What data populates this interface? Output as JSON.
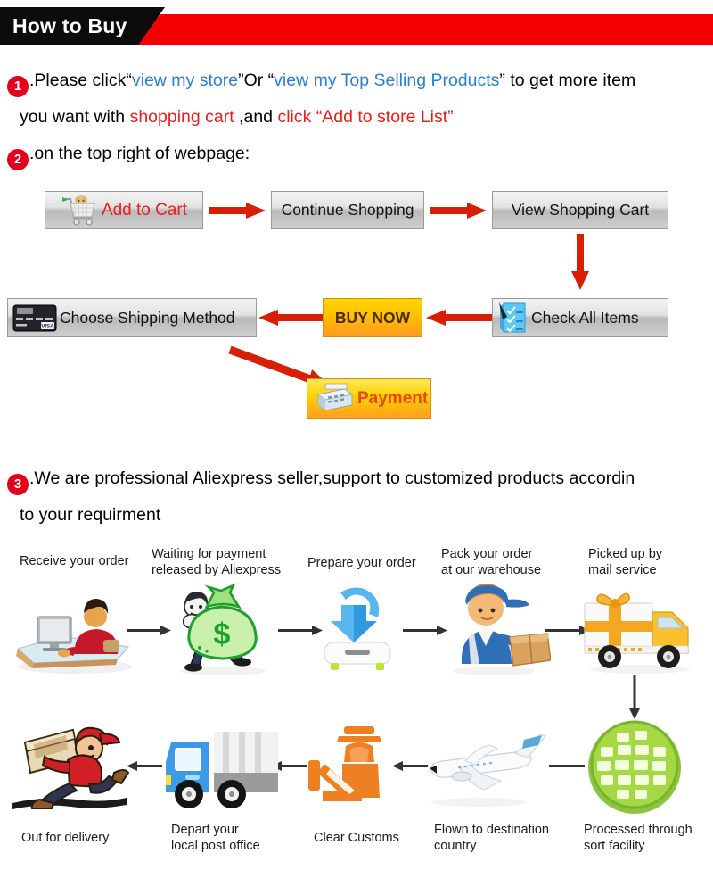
{
  "header": {
    "title": "How to Buy",
    "black_color": "#0c0c0c",
    "red_color": "#f40000"
  },
  "steps": {
    "one": {
      "number": "1",
      "line1_a": ".Please click“",
      "line1_link1": "view my store",
      "line1_b": "”Or “",
      "line1_link2": "view my Top Selling Products",
      "line1_c": "” to get more item",
      "line2_a": "you want with ",
      "line2_red1": "shopping cart",
      "line2_b": " ,and ",
      "line2_red2": "click “Add to store List”"
    },
    "two": {
      "number": "2",
      "text": ".on the top right of webpage:"
    },
    "three": {
      "number": "3",
      "line1": ".We are professional Aliexpress seller,support to customized products accordin",
      "line2": "to your requirment"
    }
  },
  "buttons": {
    "add_to_cart": "Add to Cart",
    "continue_shopping": "Continue Shopping",
    "view_shopping_cart": "View Shopping Cart",
    "choose_shipping_method": "Choose Shipping Method",
    "buy_now": "BUY NOW",
    "check_all_items": "Check All Items",
    "payment": "Payment",
    "visa_label": "VISA"
  },
  "process": {
    "top_row": [
      {
        "label_line1": "Receive your order",
        "label_line2": "",
        "icon": "person-at-computer-icon"
      },
      {
        "label_line1": "Waiting for payment",
        "label_line2": "released by Aliexpress",
        "icon": "money-bag-icon"
      },
      {
        "label_line1": "Prepare your order",
        "label_line2": "",
        "icon": "download-arrow-icon"
      },
      {
        "label_line1": "Pack your order",
        "label_line2": "at our warehouse",
        "icon": "warehouse-worker-icon"
      },
      {
        "label_line1": "Picked up by",
        "label_line2": "mail service",
        "icon": "gift-truck-icon"
      }
    ],
    "bottom_row": [
      {
        "label_line1": "Out for delivery",
        "label_line2": "",
        "icon": "running-courier-icon"
      },
      {
        "label_line1": "Depart your",
        "label_line2": "local post office",
        "icon": "post-truck-icon"
      },
      {
        "label_line1": "Clear Customs",
        "label_line2": "",
        "icon": "customs-officer-icon"
      },
      {
        "label_line1": "Flown to destination",
        "label_line2": "country",
        "icon": "airplane-icon"
      },
      {
        "label_line1": "Processed through",
        "label_line2": "sort facility",
        "icon": "globe-sort-icon"
      }
    ],
    "money_symbol": "$"
  },
  "colors": {
    "accent_red": "#e2001a",
    "link_blue": "#2a7fd4",
    "arrow_red": "#d81e05",
    "arrow_dark": "#333333"
  }
}
